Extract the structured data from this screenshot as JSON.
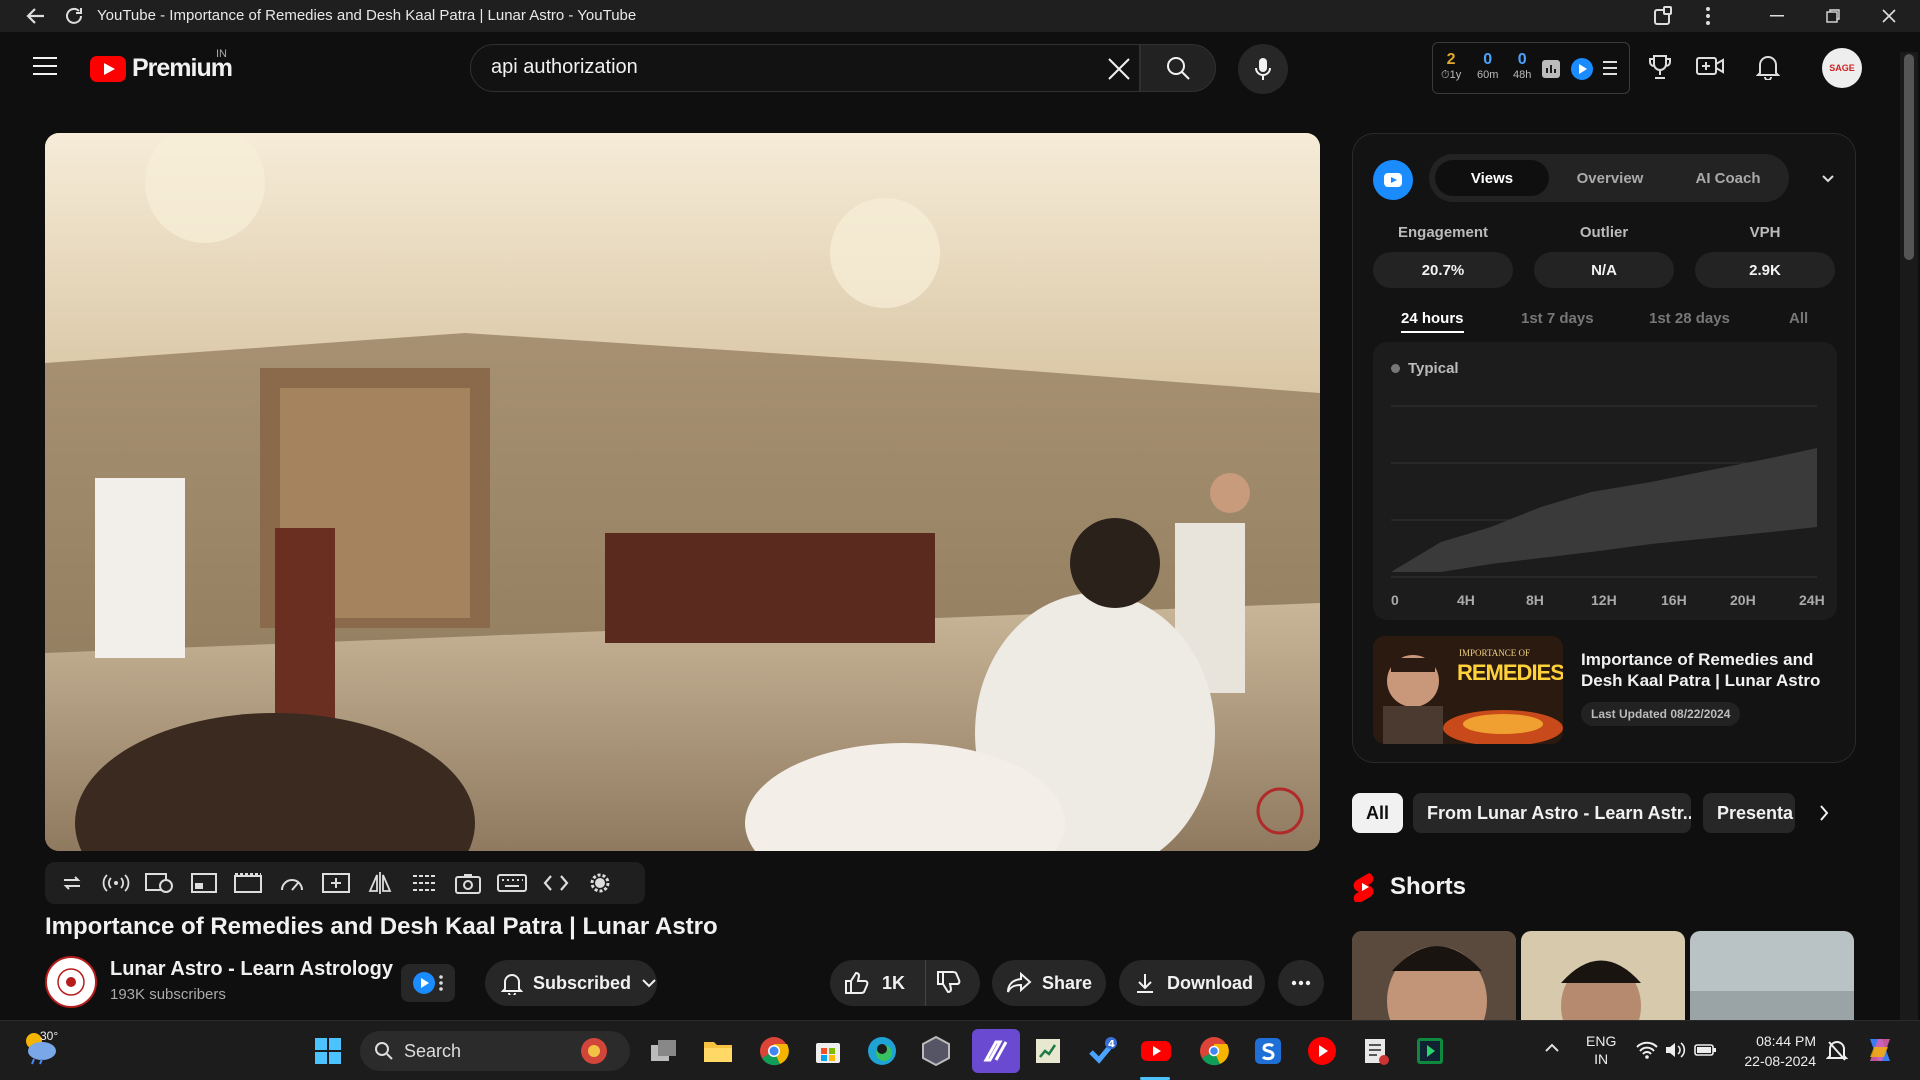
{
  "window": {
    "title": "YouTube - Importance of Remedies and Desh Kaal Patra | Lunar Astro - YouTube"
  },
  "masthead": {
    "logo_text": "Premium",
    "region": "IN",
    "search_value": "api authorization",
    "ext_stats": [
      {
        "value": "2",
        "label": "1y",
        "color": "#e0a92c"
      },
      {
        "value": "0",
        "label": "60m",
        "color": "#4aa3ff"
      },
      {
        "value": "0",
        "label": "48h",
        "color": "#4aa3ff"
      }
    ],
    "avatar_text": "SAGE"
  },
  "video": {
    "title": "Importance of Remedies and Desh Kaal Patra | Lunar Astro",
    "channel_name": "Lunar Astro - Learn Astrology",
    "subscribers": "193K subscribers",
    "subscribe_label": "Subscribed",
    "like_count": "1K",
    "share_label": "Share",
    "download_label": "Download"
  },
  "vidiq": {
    "tabs": [
      "Views",
      "Overview",
      "AI Coach"
    ],
    "active_tab": "Views",
    "metrics": [
      {
        "label": "Engagement",
        "value": "20.7%"
      },
      {
        "label": "Outlier",
        "value": "N/A"
      },
      {
        "label": "VPH",
        "value": "2.9K"
      }
    ],
    "periods": [
      "24 hours",
      "1st 7 days",
      "1st 28 days",
      "All"
    ],
    "active_period": "24 hours",
    "legend": "Typical",
    "x_ticks": [
      "0",
      "4H",
      "8H",
      "12H",
      "16H",
      "20H",
      "24H"
    ],
    "card": {
      "thumb_top": "IMPORTANCE OF",
      "thumb_big": "REMEDIES",
      "title": "Importance of Remedies and Desh Kaal Patra | Lunar Astro",
      "updated": "Last Updated 08/22/2024"
    }
  },
  "chips": [
    "All",
    "From Lunar Astro - Learn Astr...",
    "Presenta"
  ],
  "shorts": {
    "heading": "Shorts"
  },
  "taskbar": {
    "weather": "30°",
    "search_label": "Search",
    "lang_top": "ENG",
    "lang_bottom": "IN",
    "time": "08:44 PM",
    "date": "22-08-2024"
  }
}
